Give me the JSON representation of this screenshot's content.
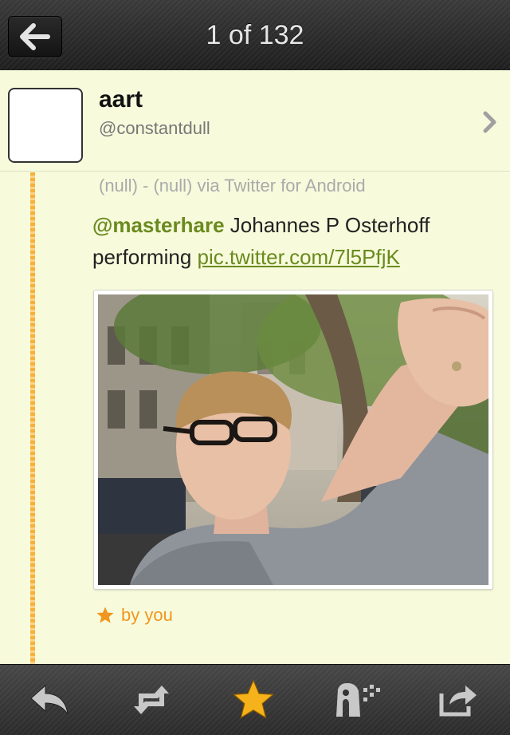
{
  "header": {
    "title": "1 of 132",
    "back_icon": "arrow-left-icon"
  },
  "profile": {
    "name": "aart",
    "handle": "@constantdull",
    "chevron_icon": "chevron-right-icon"
  },
  "tweet": {
    "meta": "(null) - (null) via Twitter for Android",
    "mention": "@masterhare",
    "text": " Johannes P Osterhoff performing ",
    "link": "pic.twitter.com/7l5PfjK",
    "favorited_by": "by you"
  },
  "toolbar": {
    "items": [
      {
        "icon": "reply-icon"
      },
      {
        "icon": "retweet-icon"
      },
      {
        "icon": "star-icon",
        "active": true
      },
      {
        "icon": "translate-icon"
      },
      {
        "icon": "share-icon"
      }
    ]
  },
  "colors": {
    "background": "#f7fbdc",
    "accent_green": "#6a8a1e",
    "favorite_orange": "#f0961e",
    "star_yellow": "#f6b21a"
  }
}
